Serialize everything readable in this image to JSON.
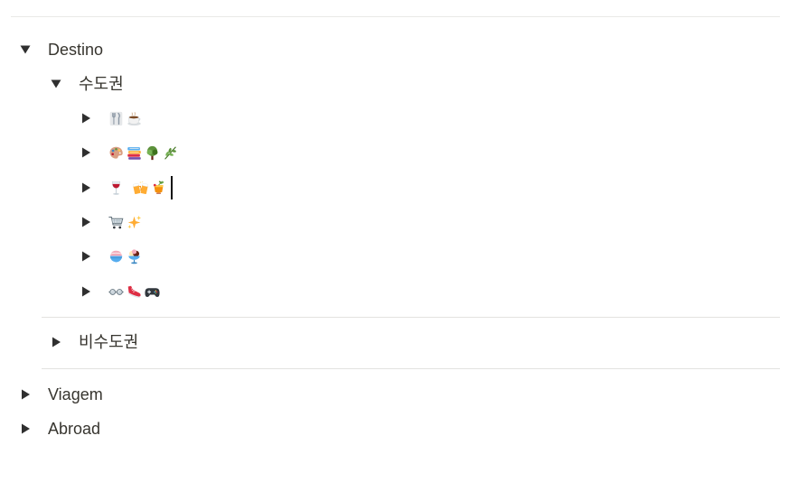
{
  "tree": {
    "destino": {
      "label": "Destino",
      "expanded": true,
      "sudogwon": {
        "label": "수도권",
        "expanded": true,
        "children": [
          {
            "icons": [
              "fork-and-knife-icon",
              "hot-beverage-icon"
            ]
          },
          {
            "icons": [
              "artist-palette-icon",
              "books-icon",
              "deciduous-tree-icon",
              "herb-icon"
            ]
          },
          {
            "icons": [
              "wine-glass-icon",
              "clinking-beer-mugs-icon",
              "tropical-drink-icon"
            ]
          },
          {
            "icons": [
              "shopping-cart-icon",
              "sparkles-icon"
            ]
          },
          {
            "icons": [
              "shaved-ice-icon",
              "ice-cream-icon"
            ]
          },
          {
            "icons": [
              "goggles-icon",
              "running-shoe-icon",
              "video-game-icon"
            ]
          }
        ]
      },
      "bisudogwon": {
        "label": "비수도권",
        "expanded": false
      }
    },
    "viagem": {
      "label": "Viagem",
      "expanded": false
    },
    "abroad": {
      "label": "Abroad",
      "expanded": false
    }
  },
  "colors": {
    "text": "#37352f",
    "caret": "#2f2f2f",
    "divider": "#e3e2e0"
  }
}
